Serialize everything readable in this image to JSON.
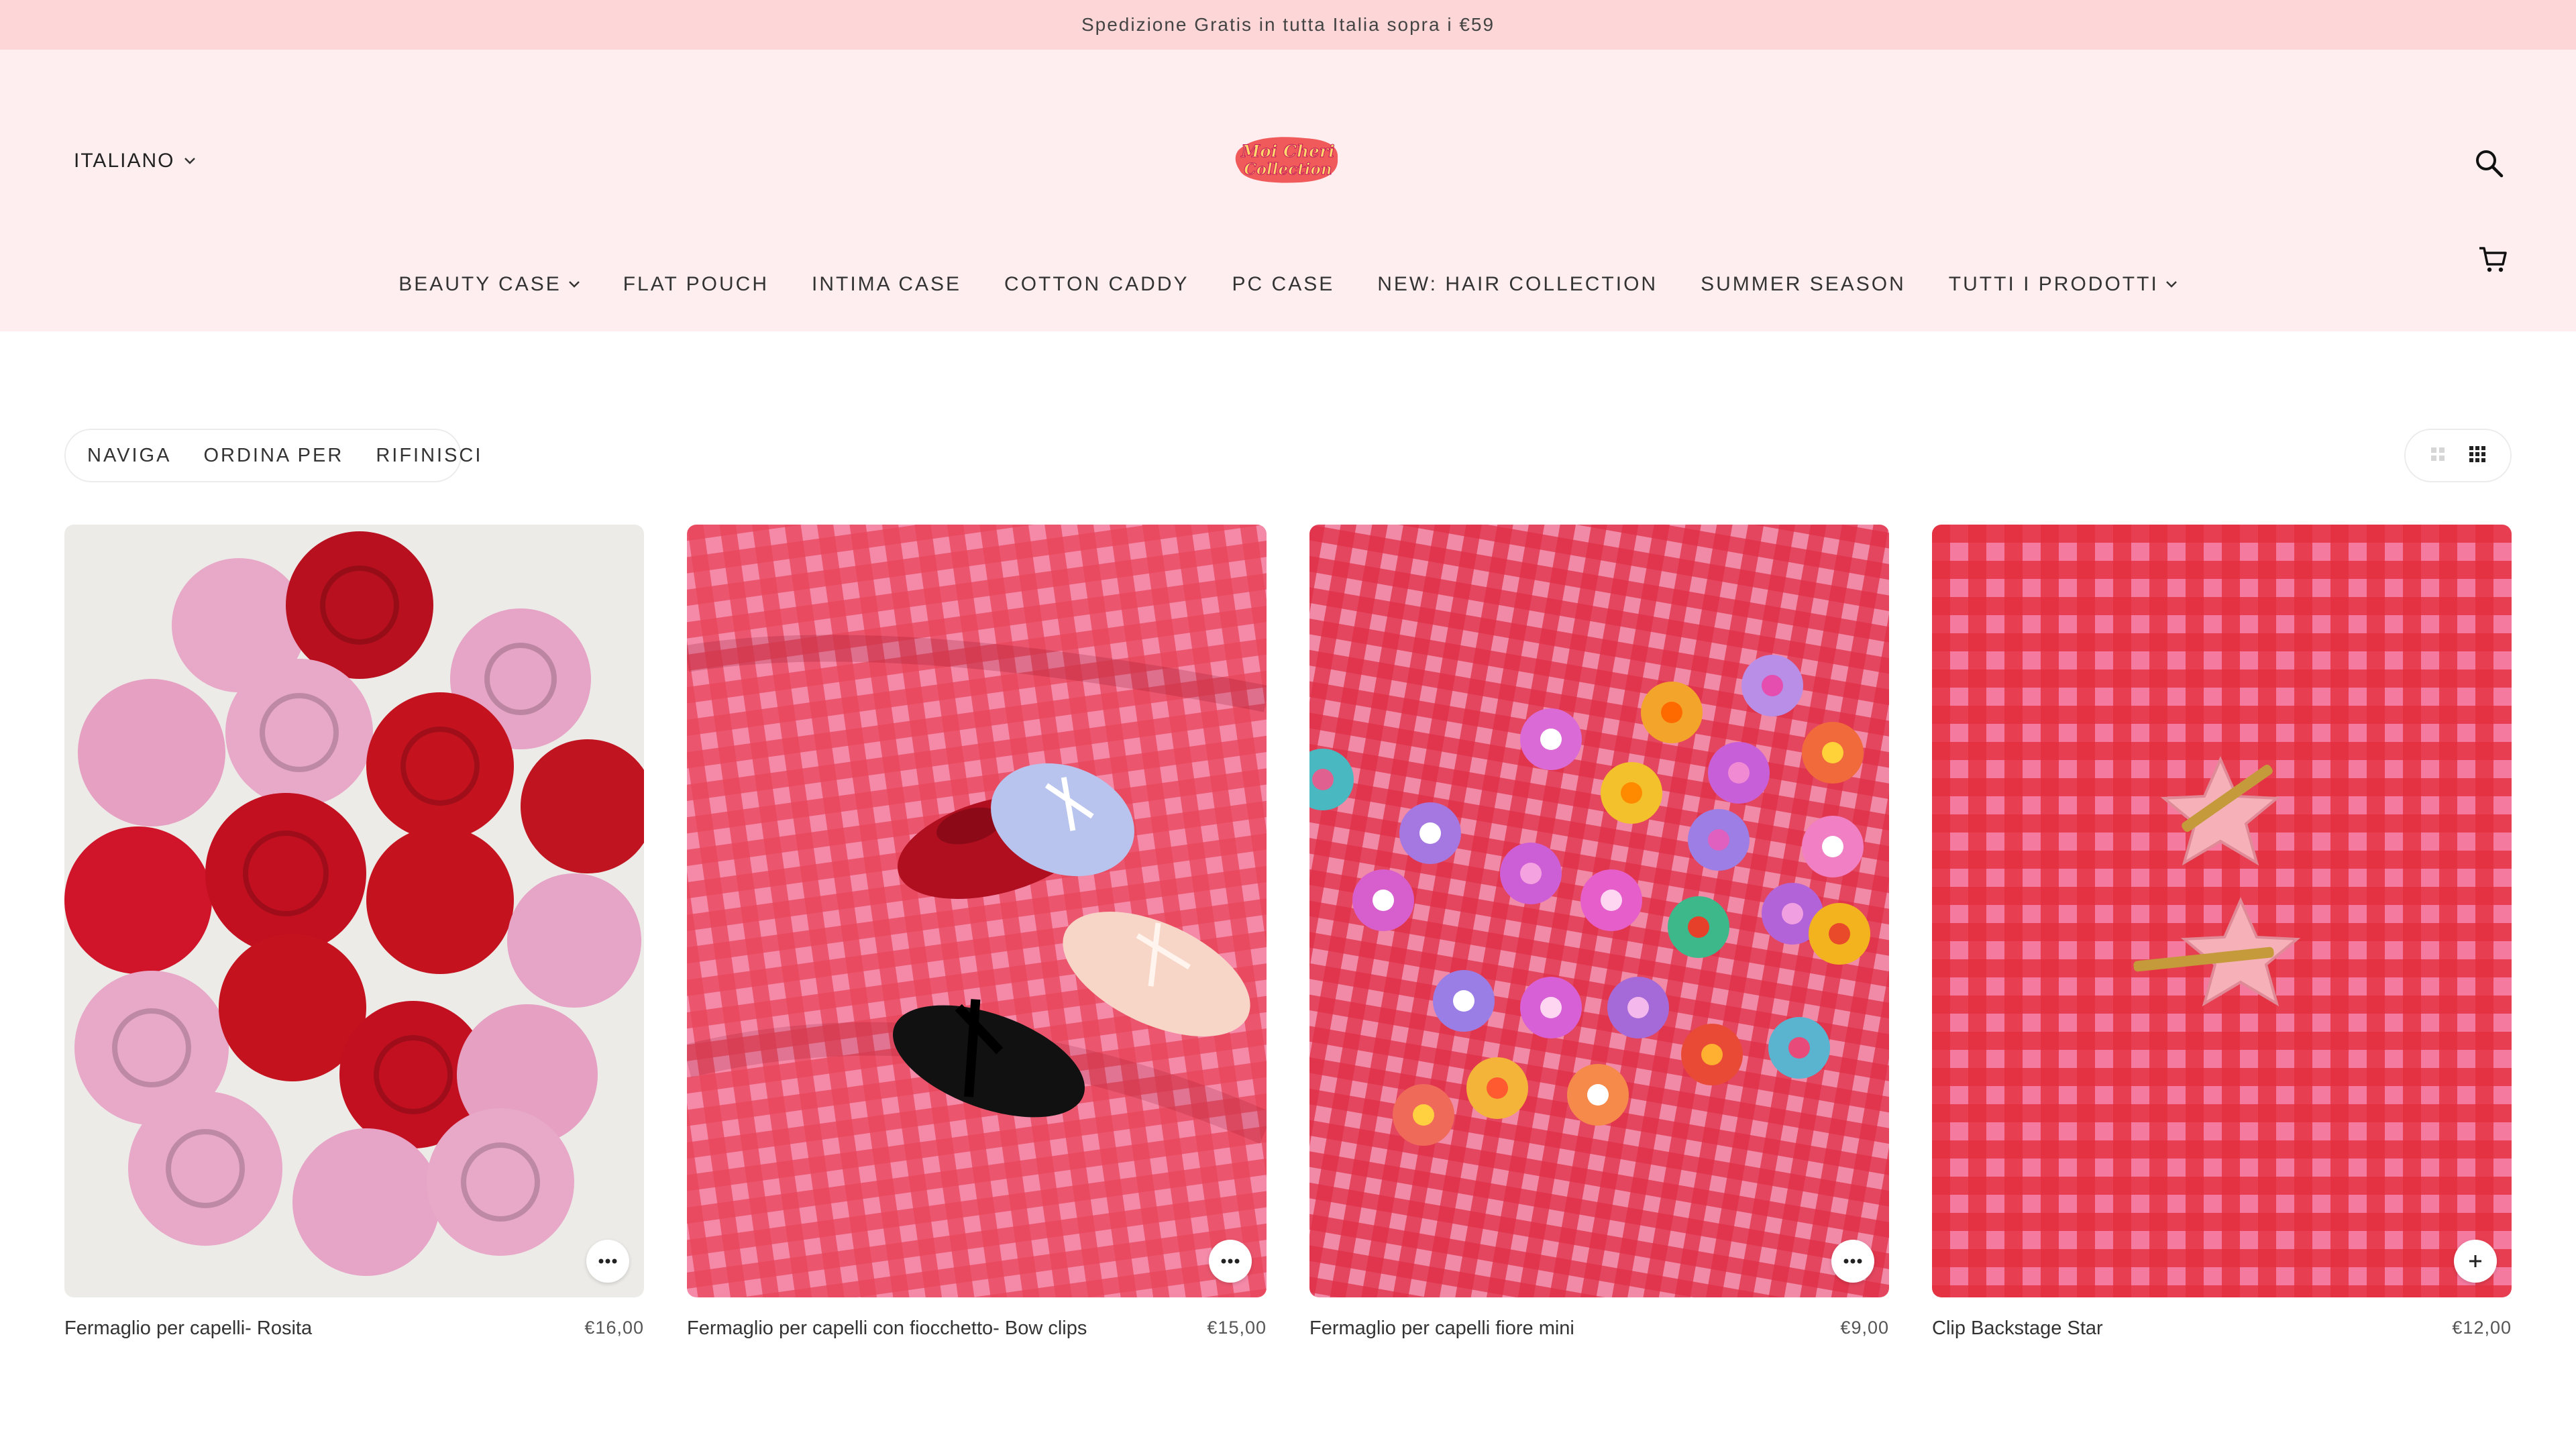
{
  "announcement": "Spedizione Gratis in tutta Italia sopra i €59",
  "header": {
    "language": "ITALIANO",
    "logo": {
      "line1": "Moi Cheri",
      "line2": "Collection"
    }
  },
  "nav": {
    "items": [
      {
        "label": "BEAUTY CASE"
      },
      {
        "label": "FLAT POUCH"
      },
      {
        "label": "INTIMA CASE"
      },
      {
        "label": "COTTON CADDY"
      },
      {
        "label": "PC CASE"
      },
      {
        "label": "NEW: HAIR COLLECTION"
      },
      {
        "label": "SUMMER SEASON"
      },
      {
        "label": "TUTTI I PRODOTTI"
      }
    ]
  },
  "filters": {
    "browse": "NAVIGA",
    "sort": "ORDINA PER",
    "refine": "RIFINISCI"
  },
  "products": [
    {
      "title": "Fermaglio per capelli- Rosita",
      "price": "€16,00",
      "action_icon": "more-icon"
    },
    {
      "title": "Fermaglio per capelli con fiocchetto- Bow clips",
      "price": "€15,00",
      "action_icon": "more-icon"
    },
    {
      "title": "Fermaglio per capelli fiore mini",
      "price": "€9,00",
      "action_icon": "more-icon"
    },
    {
      "title": "Clip Backstage Star",
      "price": "€12,00",
      "action_icon": "plus-icon"
    }
  ],
  "colors": {
    "announcement_bg": "#fdd7d8",
    "header_bg": "#ffeeef",
    "gingham_red": "#e4303f",
    "gingham_pink": "#f47aa0"
  }
}
